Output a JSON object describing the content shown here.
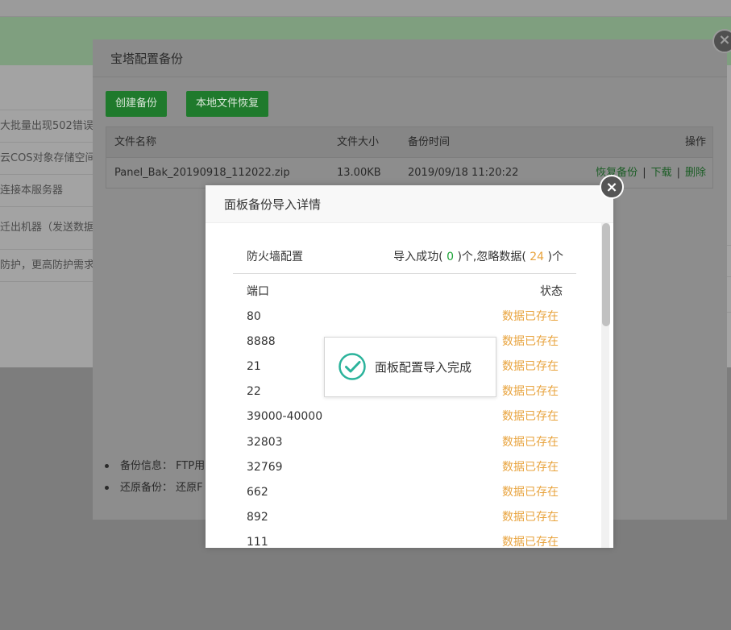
{
  "background": {
    "list_items": [
      "大批量出现502错误!",
      "云COS对象存储空间",
      "连接本服务器",
      "迁出机器（发送数据",
      "防护，更高防护需求"
    ]
  },
  "backup_dialog": {
    "title": "宝塔配置备份",
    "buttons": {
      "create": "创建备份",
      "restore_local": "本地文件恢复"
    },
    "table": {
      "headers": {
        "name": "文件名称",
        "size": "文件大小",
        "time": "备份时间",
        "ops": "操作"
      },
      "rows": [
        {
          "name": "Panel_Bak_20190918_112022.zip",
          "size": "13.00KB",
          "time": "2019/09/18 11:20:22",
          "restore": "恢复备份",
          "download": "下载",
          "delete": "删除"
        }
      ]
    },
    "separator": "|",
    "info": [
      "备份信息：  FTP用",
      "还原备份：  还原F"
    ]
  },
  "import_dialog": {
    "title": "面板备份导入详情",
    "section": {
      "title": "防火墙配置",
      "stat_prefix": "导入成功(",
      "success_count": " 0 ",
      "stat_mid": ")个,忽略数据(",
      "ignored_count": " 24 ",
      "stat_suffix": ")个"
    },
    "columns": {
      "port": "端口",
      "status": "状态"
    },
    "rows": [
      {
        "port": "80",
        "status": "数据已存在"
      },
      {
        "port": "8888",
        "status": "数据已存在"
      },
      {
        "port": "21",
        "status": "数据已存在"
      },
      {
        "port": "22",
        "status": "数据已存在"
      },
      {
        "port": "39000-40000",
        "status": "数据已存在"
      },
      {
        "port": "32803",
        "status": "数据已存在"
      },
      {
        "port": "32769",
        "status": "数据已存在"
      },
      {
        "port": "662",
        "status": "数据已存在"
      },
      {
        "port": "892",
        "status": "数据已存在"
      },
      {
        "port": "111",
        "status": "数据已存在"
      }
    ]
  },
  "toast": {
    "message": "面板配置导入完成",
    "icon": "check-circle-icon"
  },
  "colors": {
    "green_button": "#20a53a",
    "green_text": "#20a53a",
    "orange_text": "#e8a33d"
  }
}
